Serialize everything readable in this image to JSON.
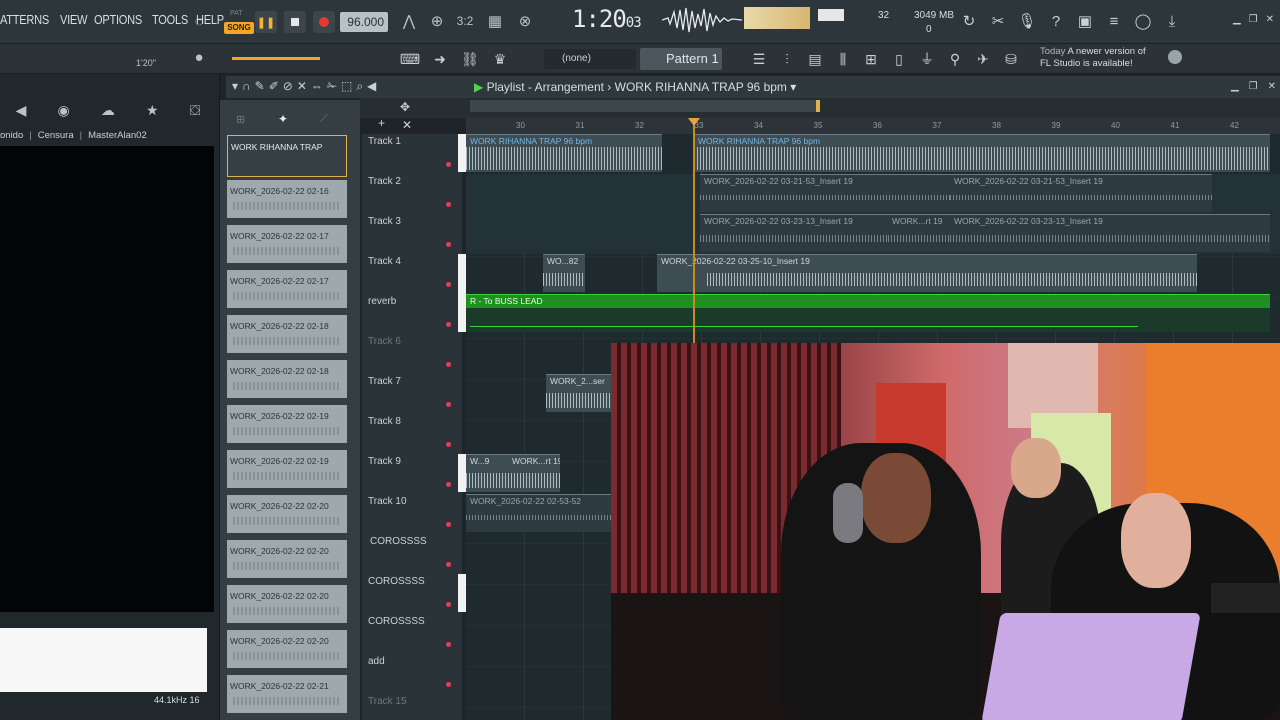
{
  "menu": [
    "ATTERNS",
    "VIEW",
    "OPTIONS",
    "TOOLS",
    "HELP"
  ],
  "transport": {
    "pat": "PAT",
    "song": "SONG",
    "tempo": "96.000",
    "time_main": "1:20",
    "time_sub": "03",
    "time_unit": "M:S:CS"
  },
  "cpu": {
    "value": "32",
    "memory": "3049 MB",
    "voices": "0"
  },
  "toolbar2": {
    "time_label": "1'20\"",
    "none_select": "(none)",
    "pattern_select": "Pattern 1"
  },
  "news": {
    "when": "Today",
    "line1": "A newer version of",
    "line2": "FL Studio is available!"
  },
  "browser": {
    "tabs": [
      "onido",
      "Censura",
      "MasterAlan02"
    ],
    "sample_rate": "44.1kHz 16"
  },
  "picker": {
    "clips": [
      "WORK RIHANNA TRAP",
      "WORK_2026-02-22 02-16",
      "WORK_2026-02-22 02-17",
      "WORK_2026-02-22 02-17",
      "WORK_2026-02-22 02-18",
      "WORK_2026-02-22 02-18",
      "WORK_2026-02-22 02-19",
      "WORK_2026-02-22 02-19",
      "WORK_2026-02-22 02-20",
      "WORK_2026-02-22 02-20",
      "WORK_2026-02-22 02-20",
      "WORK_2026-02-22 02-20",
      "WORK_2026-02-22 02-21"
    ]
  },
  "playlist": {
    "title": "Playlist - Arrangement",
    "project": "WORK RIHANNA TRAP 96 bpm",
    "ruler": [
      "30",
      "31",
      "32",
      "33",
      "34",
      "35",
      "36",
      "37",
      "38",
      "39",
      "40",
      "41",
      "42"
    ],
    "tracks": [
      "Track 1",
      "Track 2",
      "Track 3",
      "Track 4",
      "reverb",
      "Track 6",
      "Track 7",
      "Track 8",
      "Track 9",
      "Track 10",
      "COROSSSS",
      "COROSSSS",
      "COROSSSS",
      "add",
      "Track 15"
    ],
    "regions": {
      "t1a": "WORK RIHANNA TRAP 96 bpm",
      "t1b": "WORK RIHANNA TRAP 96 bpm",
      "t2a": "WORK_2026-02-22 03-21-53_Insert 19",
      "t2b": "WORK_2026-02-22 03-21-53_Insert 19",
      "t3a": "WORK_2026-02-22 03-23-13_Insert 19",
      "t3b": "WORK...rt 19",
      "t3c": "WORK_2026-02-22 03-23-13_Insert 19",
      "t4a": "WO...82",
      "t4b": "WORK_2026-02-22 03-25-10_Insert 19",
      "reverb": "R - To BUSS LEAD",
      "t7": "WORK_2...ser",
      "t9a": "W...9",
      "t9b": "WORK...rt 19",
      "t10": "WORK_2026-02-22 02-53-52"
    }
  },
  "colors": {
    "accent": "#f5a623",
    "green_clip": "#1f8f1f",
    "record": "#e53935"
  }
}
